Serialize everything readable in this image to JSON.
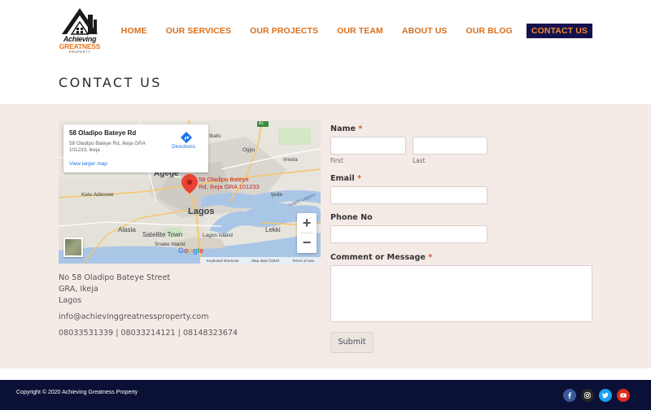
{
  "header": {
    "logo": {
      "line1": "Achieving",
      "line2": "GREATNESS",
      "line3": "PROPERTY"
    },
    "nav": [
      {
        "label": "HOME",
        "active": false
      },
      {
        "label": "OUR SERVICES",
        "active": false
      },
      {
        "label": "OUR PROJECTS",
        "active": false
      },
      {
        "label": "OUR TEAM",
        "active": false
      },
      {
        "label": "ABOUT US",
        "active": false
      },
      {
        "label": "OUR BLOG",
        "active": false
      },
      {
        "label": "CONTACT US",
        "active": true
      }
    ],
    "colors": {
      "nav_text": "#d96f1c",
      "active_bg": "#14114f",
      "active_text": "#f28b22"
    }
  },
  "page_title": "CONTACT US",
  "map": {
    "place_title": "58 Oladipo Bateye Rd",
    "place_address": "58 Oladipo Bateye Rd, Ikeja GRA 101233, Ikeja",
    "directions_label": "Directions",
    "view_larger": "View larger map",
    "pin_label_1": "58 Oladipo Bateye",
    "pin_label_2": "Rd, Ikeja GRA 101233",
    "places": {
      "ibafo": "Ibafo",
      "ogijo": "Ogijo",
      "imiota": "Imiota",
      "agege": "Agege",
      "ketu": "Ketu Adieowe",
      "lagos": "Lagos",
      "ijede": "Ijede",
      "lagos_lagoon": "Lagos Lagoon",
      "alasia": "Alasia",
      "satellite_town": "Satellite Town",
      "lagos_island": "Lagos Island",
      "lekki": "Lekki",
      "snake_island": "Snake Island",
      "a1": "A1"
    },
    "zoom_in": "+",
    "zoom_out": "−",
    "footer": {
      "shortcuts": "Keyboard shortcuts",
      "mapdata": "Map data ©2022",
      "terms": "Terms of Use"
    },
    "google": {
      "g1": "G",
      "o1": "o",
      "o2": "o",
      "g2": "g",
      "l": "l",
      "e": "e"
    }
  },
  "contact": {
    "address_line1": "No 58 Oladipo Bateye Street",
    "address_line2": "GRA, Ikeja",
    "address_line3": "Lagos",
    "email": "info@achievinggreatnessproperty.com",
    "phones": "08033531339 | 08033214121 | 08148323674"
  },
  "form": {
    "name_label": "Name",
    "name_required": "*",
    "first_label": "First",
    "last_label": "Last",
    "first_value": "",
    "last_value": "",
    "email_label": "Email",
    "email_required": "*",
    "email_value": "",
    "phone_label": "Phone No",
    "phone_value": "",
    "message_label": "Comment or Message",
    "message_required": "*",
    "message_value": "",
    "submit_label": "Submit"
  },
  "footer": {
    "copyright": "Copyright © 2020 Achieving Greatness Property",
    "social": [
      {
        "icon": "facebook-icon",
        "color": "#3b5998"
      },
      {
        "icon": "instagram-icon",
        "color": "#262626"
      },
      {
        "icon": "twitter-icon",
        "color": "#1da1f2"
      },
      {
        "icon": "youtube-icon",
        "color": "#e02a20"
      }
    ]
  }
}
